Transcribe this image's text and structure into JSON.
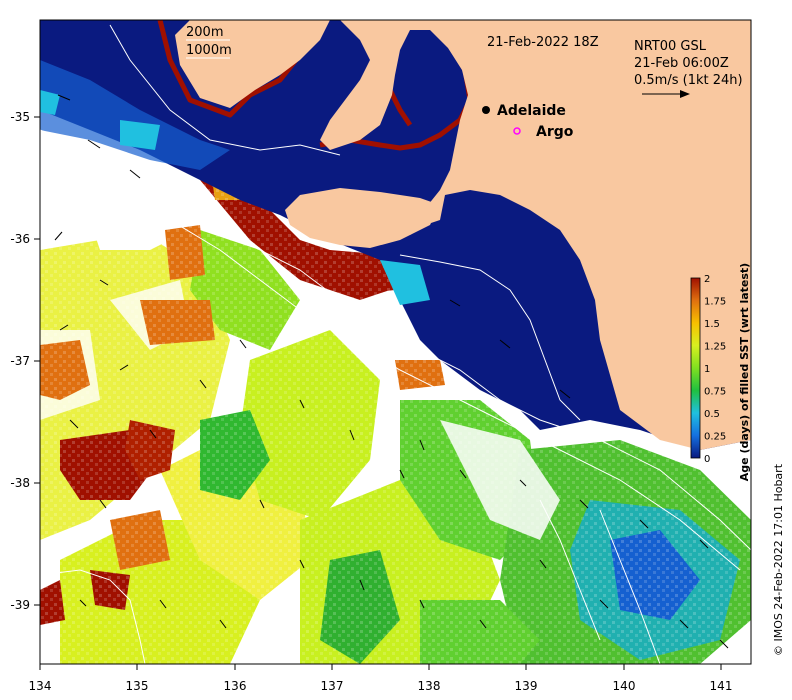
{
  "map": {
    "title": "21-Feb-2022 18Z",
    "product": "NRT00 GSL",
    "current_time": "21-Feb 06:00Z",
    "arrow_scale_label": "0.5m/s (1kt 24h)",
    "isobath_labels": [
      "200m",
      "1000m"
    ],
    "credit": "© IMOS 24-Feb-2022 17:01 Hobart",
    "colors": {
      "land": "#f9c8a0",
      "sea_blank": "#ffffff",
      "dark_blue": "#0a1a80",
      "coast_red": "#a01000"
    }
  },
  "places": [
    {
      "name": "Adelaide",
      "lon": 138.6,
      "lat": -34.93,
      "marker": "filled-circle"
    },
    {
      "name": "Argo",
      "lon": 138.9,
      "lat": -35.12,
      "marker": "magenta-circle"
    }
  ],
  "axes": {
    "lon_ticks": [
      "134",
      "135",
      "136",
      "137",
      "138",
      "139",
      "140",
      "141"
    ],
    "lat_ticks": [
      "-35",
      "-36",
      "-37",
      "-38",
      "-39"
    ],
    "lon_range": [
      134,
      141.3
    ],
    "lat_range": [
      -39.45,
      -34.2
    ]
  },
  "colorbar": {
    "title": "Age (days) of filled SST (wrt latest)",
    "tick_labels": [
      "0",
      "0.25",
      "0.5",
      "0.75",
      "1",
      "1.25",
      "1.5",
      "1.75",
      "2"
    ],
    "range": [
      0,
      2
    ],
    "colors": [
      "#0a1a80",
      "#1570e0",
      "#20c0e0",
      "#20c040",
      "#80e020",
      "#d8f020",
      "#f8c000",
      "#e07010",
      "#a01000"
    ]
  }
}
